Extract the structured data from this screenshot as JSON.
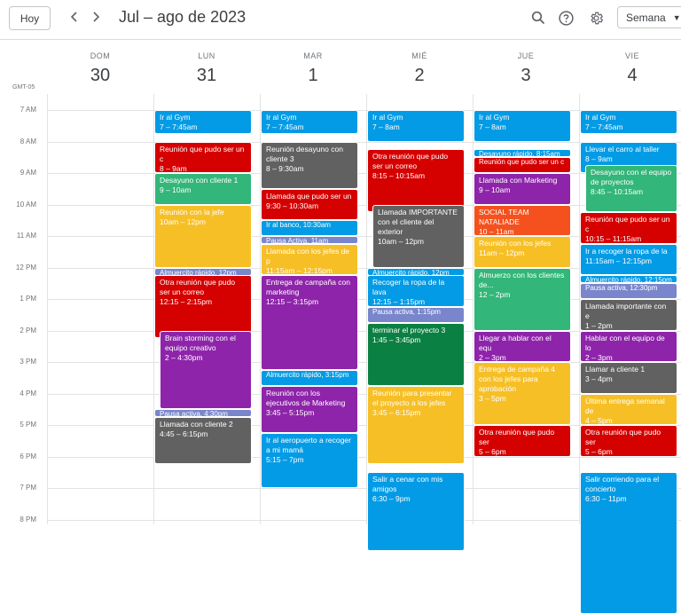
{
  "toolbar": {
    "today_label": "Hoy",
    "prev_icon": "chevron-left-icon",
    "next_icon": "chevron-right-icon",
    "period_title": "Jul – ago de 2023",
    "view_label": "Semana"
  },
  "timezone": "GMT-05",
  "days": [
    {
      "dow": "DOM",
      "num": "30"
    },
    {
      "dow": "LUN",
      "num": "31"
    },
    {
      "dow": "MAR",
      "num": "1"
    },
    {
      "dow": "MIÉ",
      "num": "2"
    },
    {
      "dow": "JUE",
      "num": "3"
    },
    {
      "dow": "VIE",
      "num": "4"
    }
  ],
  "hours": [
    "7 AM",
    "8 AM",
    "9 AM",
    "10 AM",
    "11 AM",
    "12 PM",
    "1 PM",
    "2 PM",
    "3 PM",
    "4 PM",
    "5 PM",
    "6 PM",
    "7 PM",
    "8 PM"
  ],
  "colors": {
    "blue": "#039be5",
    "red": "#d50000",
    "green": "#33b679",
    "yellow": "#f6bf26",
    "graphite": "#616161",
    "grape": "#8e24aa",
    "lavender": "#7986cb",
    "tangerine": "#f4511e",
    "basil": "#0b8043"
  },
  "events": [
    {
      "day": 1,
      "start": 7.0,
      "end": 7.75,
      "color": "blue",
      "title": "Ir al Gym",
      "time": "7 – 7:45am"
    },
    {
      "day": 1,
      "start": 8.0,
      "end": 9.0,
      "color": "red",
      "title": "Reunión que pudo ser un c",
      "time": "8 – 9am"
    },
    {
      "day": 1,
      "start": 9.0,
      "end": 10.0,
      "color": "green",
      "title": "Desayuno con cliente 1",
      "time": "9 – 10am"
    },
    {
      "day": 1,
      "start": 10.0,
      "end": 12.0,
      "color": "yellow",
      "title": "Reunión con la jefe",
      "time": "10am – 12pm"
    },
    {
      "day": 1,
      "start": 12.0,
      "end": 12.25,
      "color": "lavender",
      "title": "Almuercito rápido, 12pm",
      "time": "",
      "inline": true
    },
    {
      "day": 1,
      "start": 12.25,
      "end": 14.25,
      "color": "red",
      "title": "Otra reunión que pudo ser un correo",
      "time": "12:15 – 2:15pm"
    },
    {
      "day": 1,
      "start": 14.0,
      "end": 16.5,
      "color": "grape",
      "title": "Brain storming con el equipo creativo",
      "time": "2 – 4:30pm",
      "indent": true
    },
    {
      "day": 1,
      "start": 16.5,
      "end": 16.75,
      "color": "lavender",
      "title": "Pausa activa, 4:30pm",
      "time": "",
      "inline": true
    },
    {
      "day": 1,
      "start": 16.75,
      "end": 18.25,
      "color": "graphite",
      "title": "Llamada con cliente 2",
      "time": "4:45 – 6:15pm"
    },
    {
      "day": 2,
      "start": 7.0,
      "end": 7.75,
      "color": "blue",
      "title": "Ir al Gym",
      "time": "7 – 7:45am"
    },
    {
      "day": 2,
      "start": 8.0,
      "end": 9.5,
      "color": "graphite",
      "title": "Reunión desayuno con cliente 3",
      "time": "8 – 9:30am"
    },
    {
      "day": 2,
      "start": 9.5,
      "end": 10.5,
      "color": "red",
      "title": "Llamada que pudo ser un",
      "time": "9:30 – 10:30am"
    },
    {
      "day": 2,
      "start": 10.5,
      "end": 11.0,
      "color": "blue",
      "title": "Ir al banco, 10:30am",
      "time": "",
      "inline": true
    },
    {
      "day": 2,
      "start": 11.0,
      "end": 11.25,
      "color": "lavender",
      "title": "Pausa Activa, 11am",
      "time": "",
      "inline": true
    },
    {
      "day": 2,
      "start": 11.25,
      "end": 12.25,
      "color": "yellow",
      "title": "Llamada con los jefes de p",
      "time": "11:15am – 12:15pm"
    },
    {
      "day": 2,
      "start": 12.25,
      "end": 15.25,
      "color": "grape",
      "title": "Entrega de campaña con marketing",
      "time": "12:15 – 3:15pm"
    },
    {
      "day": 2,
      "start": 15.25,
      "end": 15.75,
      "color": "blue",
      "title": "Almuercito rápido, 3:15pm",
      "time": "",
      "inline": true
    },
    {
      "day": 2,
      "start": 15.75,
      "end": 17.25,
      "color": "grape",
      "title": "Reunión con los ejecutivos de Marketing",
      "time": "3:45 – 5:15pm"
    },
    {
      "day": 2,
      "start": 17.25,
      "end": 19.0,
      "color": "blue",
      "title": "Ir al aeropuerto a recoger a mi mamá",
      "time": "5:15 – 7pm"
    },
    {
      "day": 3,
      "start": 7.0,
      "end": 8.0,
      "color": "blue",
      "title": "Ir al Gym",
      "time": "7 – 8am"
    },
    {
      "day": 3,
      "start": 8.25,
      "end": 10.25,
      "color": "red",
      "title": "Otra reunión que pudo ser un correo",
      "time": "8:15 – 10:15am"
    },
    {
      "day": 3,
      "start": 10.0,
      "end": 12.0,
      "color": "graphite",
      "title": "Llamada IMPORTANTE con el cliente del exterior",
      "time": "10am – 12pm",
      "indent": true
    },
    {
      "day": 3,
      "start": 12.0,
      "end": 12.25,
      "color": "blue",
      "title": "Almuercito rápido, 12pm",
      "time": "",
      "inline": true
    },
    {
      "day": 3,
      "start": 12.25,
      "end": 13.25,
      "color": "blue",
      "title": "Recoger la ropa de la lava",
      "time": "12:15 – 1:15pm"
    },
    {
      "day": 3,
      "start": 13.25,
      "end": 13.75,
      "color": "lavender",
      "title": "Pausa activa, 1:15pm",
      "time": "",
      "inline": true
    },
    {
      "day": 3,
      "start": 13.75,
      "end": 15.75,
      "color": "basil",
      "title": "terminar el proyecto 3",
      "time": "1:45 – 3:45pm"
    },
    {
      "day": 3,
      "start": 15.75,
      "end": 18.25,
      "color": "yellow",
      "title": "Reunión para presentar el proyecto a los jefes",
      "time": "3:45 – 6:15pm"
    },
    {
      "day": 3,
      "start": 18.5,
      "end": 21.0,
      "color": "blue",
      "title": "Salir a cenar con mis amigos",
      "time": "6:30 – 9pm"
    },
    {
      "day": 4,
      "start": 7.0,
      "end": 8.0,
      "color": "blue",
      "title": "Ir al Gym",
      "time": "7 – 8am"
    },
    {
      "day": 4,
      "start": 8.25,
      "end": 8.5,
      "color": "blue",
      "title": "Desayuno rápido, 8:15am",
      "time": "",
      "inline": true
    },
    {
      "day": 4,
      "start": 8.5,
      "end": 9.0,
      "color": "red",
      "title": "Reunión que pudo ser un c",
      "time": "",
      "inline": true
    },
    {
      "day": 4,
      "start": 9.0,
      "end": 10.0,
      "color": "grape",
      "title": "Llamada con Marketing",
      "time": "9 – 10am"
    },
    {
      "day": 4,
      "start": 10.0,
      "end": 11.0,
      "color": "tangerine",
      "title": "SOCIAL TEAM NATALIADE",
      "time": "10 – 11am"
    },
    {
      "day": 4,
      "start": 11.0,
      "end": 12.0,
      "color": "yellow",
      "title": "Reunión con los jefes",
      "time": "11am – 12pm"
    },
    {
      "day": 4,
      "start": 12.0,
      "end": 14.0,
      "color": "green",
      "title": "Almuerzo con los clientes de...",
      "time": "12 – 2pm"
    },
    {
      "day": 4,
      "start": 14.0,
      "end": 15.0,
      "color": "grape",
      "title": "Llegar a hablar con el equ",
      "time": "2 – 3pm"
    },
    {
      "day": 4,
      "start": 15.0,
      "end": 17.0,
      "color": "yellow",
      "title": "Entrega de campaña 4 con los jefes para aprobación",
      "time": "3 – 5pm"
    },
    {
      "day": 4,
      "start": 17.0,
      "end": 18.0,
      "color": "red",
      "title": "Otra reunión que pudo ser",
      "time": "5 – 6pm"
    },
    {
      "day": 5,
      "start": 7.0,
      "end": 7.75,
      "color": "blue",
      "title": "Ir al Gym",
      "time": "7 – 7:45am"
    },
    {
      "day": 5,
      "start": 8.0,
      "end": 9.0,
      "color": "blue",
      "title": "Llevar el carro al taller",
      "time": "8 – 9am"
    },
    {
      "day": 5,
      "start": 8.75,
      "end": 10.25,
      "color": "green",
      "title": "Desayuno con el equipo de proyectos",
      "time": "8:45 – 10:15am",
      "indent": true
    },
    {
      "day": 5,
      "start": 10.25,
      "end": 11.25,
      "color": "red",
      "title": "Reunión que pudo ser un c",
      "time": "10:15 – 11:15am"
    },
    {
      "day": 5,
      "start": 11.25,
      "end": 12.25,
      "color": "blue",
      "title": "Ir a recoger la ropa de la",
      "time": "11:15am – 12:15pm"
    },
    {
      "day": 5,
      "start": 12.25,
      "end": 12.5,
      "color": "blue",
      "title": "Almuercito rápido, 12:15pm",
      "time": "",
      "inline": true
    },
    {
      "day": 5,
      "start": 12.5,
      "end": 13.0,
      "color": "lavender",
      "title": "Pausa activa, 12:30pm",
      "time": "",
      "inline": true
    },
    {
      "day": 5,
      "start": 13.0,
      "end": 14.0,
      "color": "graphite",
      "title": "Llamada importante con e",
      "time": "1 – 2pm"
    },
    {
      "day": 5,
      "start": 14.0,
      "end": 15.0,
      "color": "grape",
      "title": "Hablar con el equipo de lo",
      "time": "2 – 3pm"
    },
    {
      "day": 5,
      "start": 15.0,
      "end": 16.0,
      "color": "graphite",
      "title": "Llamar a cliente 1",
      "time": "3 – 4pm"
    },
    {
      "day": 5,
      "start": 16.0,
      "end": 17.0,
      "color": "yellow",
      "title": "Última entrega semanal de",
      "time": "4 – 5pm"
    },
    {
      "day": 5,
      "start": 17.0,
      "end": 18.0,
      "color": "red",
      "title": "Otra reunión que pudo ser",
      "time": "5 – 6pm"
    },
    {
      "day": 5,
      "start": 18.5,
      "end": 23.0,
      "color": "blue",
      "title": "Salir corriendo para el concierto",
      "time": "6:30 – 11pm"
    }
  ]
}
